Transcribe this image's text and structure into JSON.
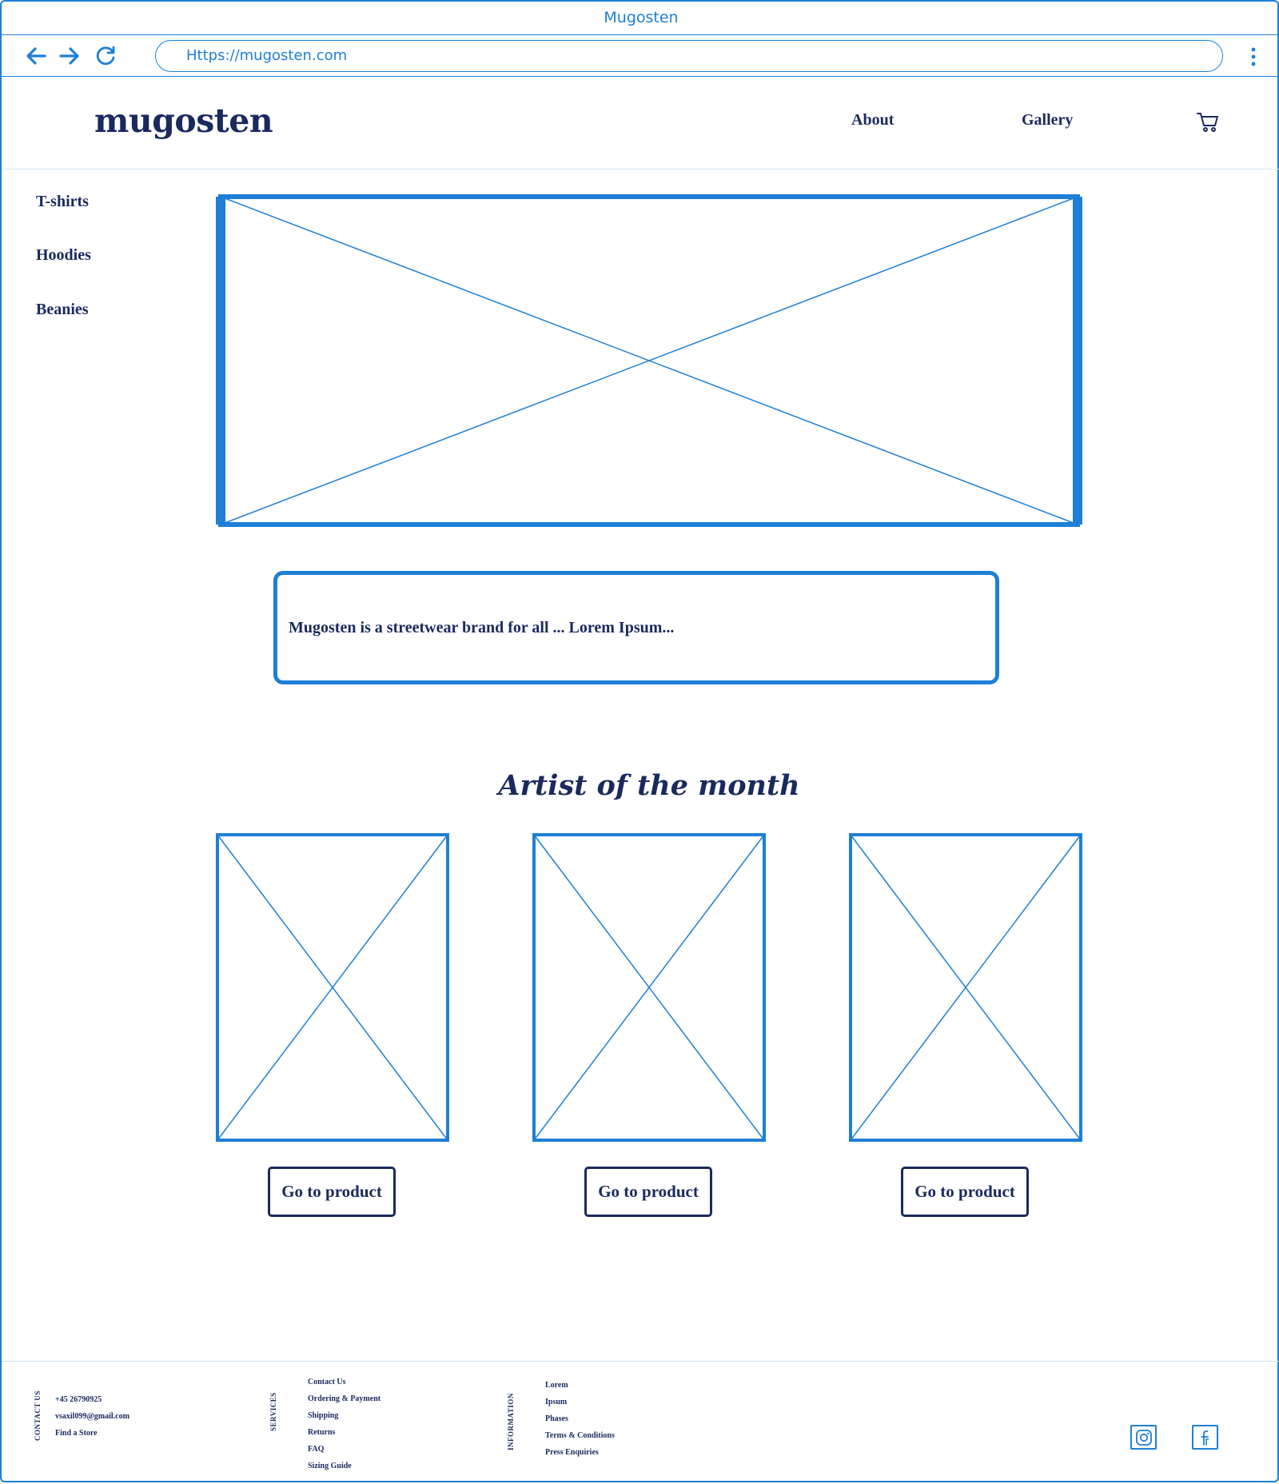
{
  "browser": {
    "window_title": "Mugosten",
    "url": "Https://mugosten.com",
    "icons": [
      "back-arrow-icon",
      "forward-arrow-icon",
      "reload-icon",
      "kebab-menu-icon"
    ]
  },
  "header": {
    "logo": "mugosten",
    "nav": [
      "About",
      "Gallery"
    ],
    "cart_icon": "cart-icon"
  },
  "sidebar": {
    "items": [
      "T-shirts",
      "Hoodies",
      "Beanies"
    ]
  },
  "about": {
    "text": "Mugosten is a streetwear brand for all ... Lorem Ipsum..."
  },
  "artist": {
    "title": "Artist of the month",
    "buttons": [
      "Go to product",
      "Go to product",
      "Go to product"
    ]
  },
  "footer": {
    "contact": {
      "label": "CONTACT US",
      "items": [
        "+45 26790925",
        "vsaxil099@gmail.com",
        "Find a Store"
      ]
    },
    "services": {
      "label": "SERVICES",
      "items": [
        "Contact Us",
        "Ordering & Payment",
        "Shipping",
        "Returns",
        "FAQ",
        "Sizing Guide"
      ]
    },
    "information": {
      "label": "INFORMATION",
      "items": [
        "Lorem",
        "Ipsum",
        "Phases",
        "Terms & Conditions",
        "Press Enquiries"
      ]
    },
    "social": [
      "instagram-icon",
      "facebook-icon"
    ]
  },
  "colors": {
    "accent": "#1e7fd6",
    "text": "#1a2a5e"
  }
}
